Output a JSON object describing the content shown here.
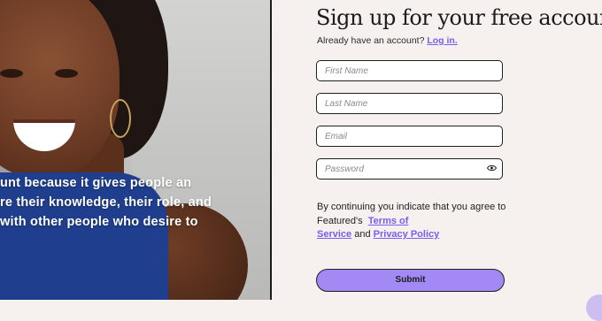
{
  "quote": {
    "lines": [
      "unt because it gives people an",
      "re their knowledge, their role, and",
      "with other people who desire to"
    ]
  },
  "form": {
    "heading": "Sign up for your free account",
    "have_account_text": "Already have an account?",
    "login_link": "Log in.",
    "fields": {
      "first_name_placeholder": "First Name",
      "last_name_placeholder": "Last Name",
      "email_placeholder": "Email",
      "password_placeholder": "Password"
    },
    "terms_prefix": "By continuing you indicate that you agree to Featured's",
    "terms_link_1": "Terms of",
    "terms_link_2": "Service",
    "terms_and": "and",
    "privacy_link": "Privacy Policy",
    "submit_label": "Submit"
  },
  "colors": {
    "accent": "#a389f4",
    "link": "#7a5cf0",
    "background": "#f6f1ee"
  }
}
